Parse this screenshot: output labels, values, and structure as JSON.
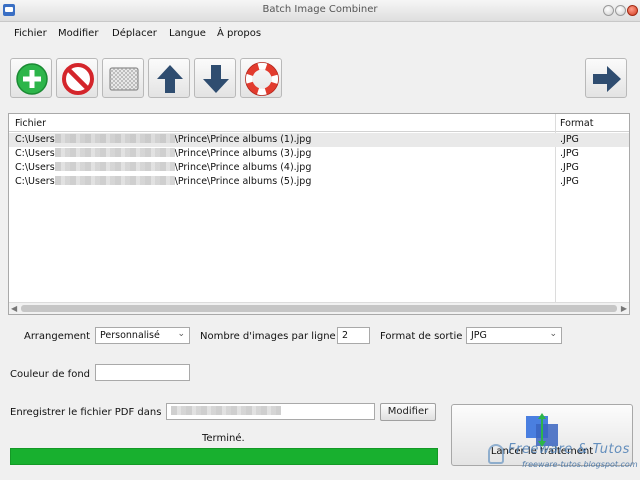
{
  "window": {
    "title": "Batch Image Combiner"
  },
  "menu": [
    "Fichier",
    "Modifier",
    "Déplacer",
    "Langue",
    "À propos"
  ],
  "toolbar": {
    "buttons": [
      {
        "icon": "add-icon"
      },
      {
        "icon": "remove-icon"
      },
      {
        "icon": "clear-icon"
      },
      {
        "icon": "arrow-up-icon"
      },
      {
        "icon": "arrow-down-icon"
      },
      {
        "icon": "help-icon"
      }
    ],
    "next_icon": "arrow-right-icon"
  },
  "table": {
    "headers": {
      "file": "Fichier",
      "format": "Format"
    },
    "rows": [
      {
        "path_start": "C:\\Users",
        "path_end": "\\Prince\\Prince albums (1).jpg",
        "format": ".JPG"
      },
      {
        "path_start": "C:\\Users",
        "path_end": "\\Prince\\Prince albums (3).jpg",
        "format": ".JPG"
      },
      {
        "path_start": "C:\\Users",
        "path_end": "\\Prince\\Prince albums (4).jpg",
        "format": ".JPG"
      },
      {
        "path_start": "C:\\Users",
        "path_end": "\\Prince\\Prince albums (5).jpg",
        "format": ".JPG"
      }
    ]
  },
  "options": {
    "arrangement_label": "Arrangement",
    "arrangement_value": "Personnalisé",
    "images_per_row_label": "Nombre d'images par ligne",
    "images_per_row_value": "2",
    "output_format_label": "Format de sortie",
    "output_format_value": "JPG",
    "background_label": "Couleur de fond",
    "save_pdf_label": "Enregistrer le fichier PDF dans",
    "modify_button": "Modifier"
  },
  "status": {
    "text": "Terminé.",
    "progress": 1.0,
    "color": "#18b02f"
  },
  "start_button": {
    "label": "Lancer le traitement"
  },
  "watermark": {
    "brand": "Freeware & Tutos",
    "url": "freeware-tutos.blogspot.com"
  }
}
